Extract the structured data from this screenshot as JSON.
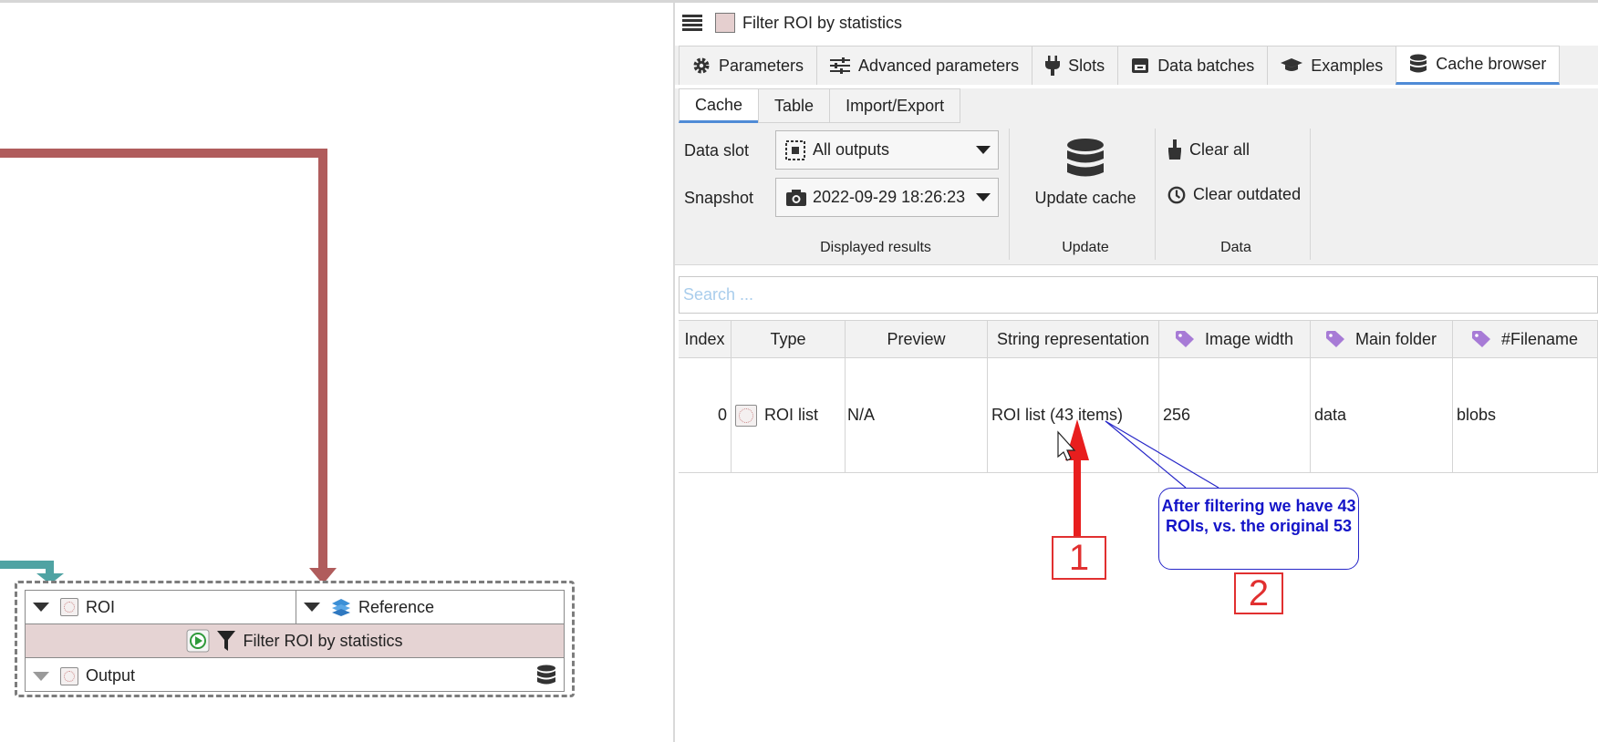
{
  "node": {
    "input_roi_label": "ROI",
    "input_reference_label": "Reference",
    "title": "Filter ROI by statistics",
    "output_label": "Output"
  },
  "panel": {
    "title": "Filter ROI by statistics",
    "tabs": [
      {
        "label": "Parameters",
        "icon": "gear-icon"
      },
      {
        "label": "Advanced parameters",
        "icon": "sliders-icon"
      },
      {
        "label": "Slots",
        "icon": "plug-icon"
      },
      {
        "label": "Data batches",
        "icon": "archive-icon"
      },
      {
        "label": "Examples",
        "icon": "graduation-cap-icon"
      },
      {
        "label": "Cache browser",
        "icon": "database-icon"
      }
    ],
    "active_tab": "Cache browser",
    "subtabs": [
      "Cache",
      "Table",
      "Import/Export"
    ],
    "active_subtab": "Cache"
  },
  "ribbon": {
    "data_slot_label": "Data slot",
    "data_slot_value": "All outputs",
    "snapshot_label": "Snapshot",
    "snapshot_value": "2022-09-29 18:26:23",
    "group_displayed": "Displayed results",
    "update_cache_label": "Update cache",
    "group_update": "Update",
    "clear_all_label": "Clear all",
    "clear_outdated_label": "Clear outdated",
    "group_data": "Data"
  },
  "search": {
    "placeholder": "Search ..."
  },
  "table": {
    "headers": [
      "Index",
      "Type",
      "Preview",
      "String representation",
      "Image width",
      "Main folder",
      "#Filename"
    ],
    "rows": [
      {
        "index": "0",
        "type": "ROI list",
        "preview": "N/A",
        "string": "ROI list (43 items)",
        "image_width": "256",
        "main_folder": "data",
        "filename": "blobs"
      }
    ]
  },
  "annotations": {
    "callout_text": "After filtering we have 43 ROIs, vs. the original 53",
    "marker_1": "1",
    "marker_2": "2"
  },
  "colors": {
    "edge_red": "#b05c5c",
    "edge_teal": "#4fa3a3",
    "node_title_bg": "#e5d3d3",
    "tab_accent": "#4f8bd6",
    "annotation_red": "#e13030",
    "annotation_blue": "#1414c8",
    "tag_purple": "#a77bd6"
  }
}
